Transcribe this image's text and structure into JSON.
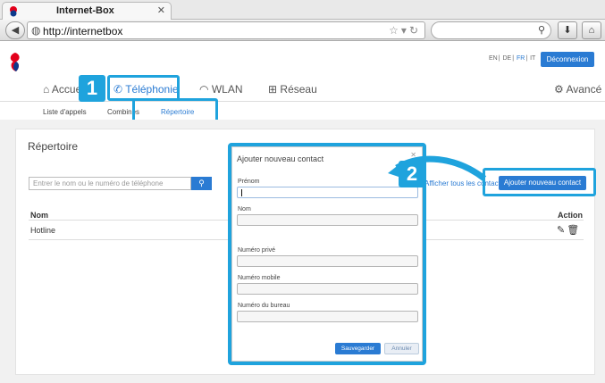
{
  "browser": {
    "tab_title": "Internet-Box",
    "url": "http://internetbox"
  },
  "header": {
    "languages": [
      "EN",
      "DE",
      "FR",
      "IT"
    ],
    "active_language": "FR",
    "logout_label": "Déconnexion"
  },
  "main_nav": {
    "home": "Accueil",
    "telephony": "Téléphonie",
    "wlan": "WLAN",
    "network": "Réseau",
    "advanced": "Avancé"
  },
  "sub_nav": {
    "call_list": "Liste d'appels",
    "handsets": "Combinés",
    "directory": "Répertoire"
  },
  "callouts": {
    "step1": "1",
    "step2": "2"
  },
  "directory": {
    "title": "Répertoire",
    "search_placeholder": "Entrer le nom ou le numéro de téléphone",
    "view_all_label": "Afficher tous les contacts",
    "add_contact_label": "Ajouter nouveau contact",
    "columns": {
      "name": "Nom",
      "action": "Action"
    },
    "rows": [
      {
        "name": "Hotline"
      }
    ]
  },
  "modal": {
    "title": "Ajouter nouveau contact",
    "fields": {
      "first_name": "Prénom",
      "last_name": "Nom",
      "private_number": "Numéro privé",
      "mobile_number": "Numéro mobile",
      "office_number": "Numéro du bureau"
    },
    "save_label": "Sauvegarder",
    "cancel_label": "Annuler"
  },
  "colors": {
    "accent": "#2a7bd3",
    "highlight": "#1fa3dd"
  }
}
